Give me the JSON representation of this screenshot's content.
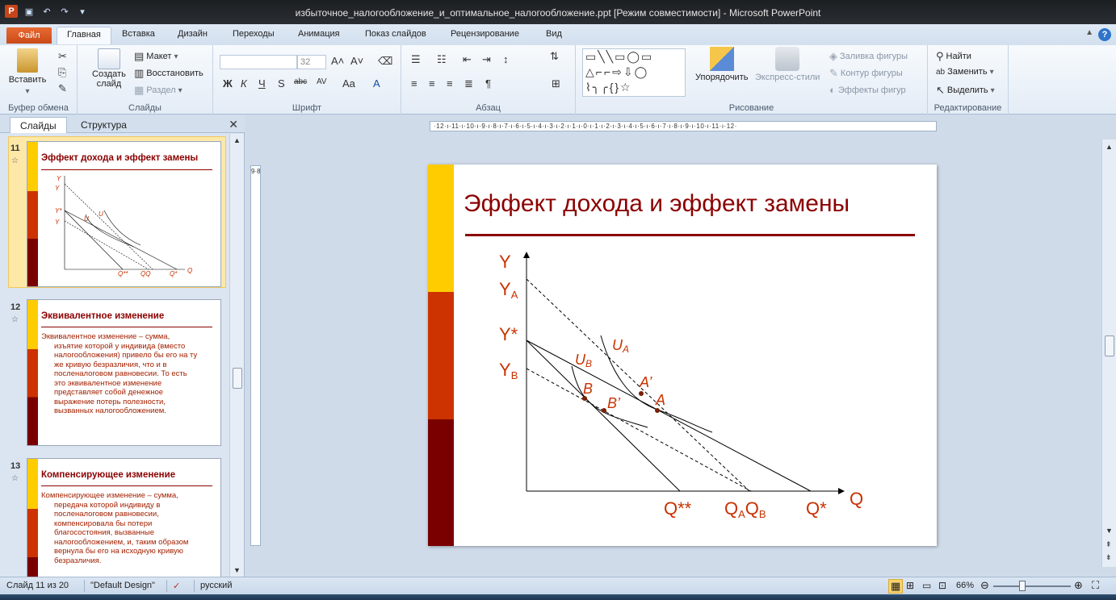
{
  "window": {
    "title": "избыточное_налогообложение_и_оптимальное_налогообложение.ppt [Режим совместимости] - Microsoft PowerPoint"
  },
  "tabs": {
    "file": "Файл",
    "items": [
      "Главная",
      "Вставка",
      "Дизайн",
      "Переходы",
      "Анимация",
      "Показ слайдов",
      "Рецензирование",
      "Вид"
    ]
  },
  "ribbon": {
    "clipboard": {
      "paste": "Вставить",
      "label": "Буфер обмена"
    },
    "slides": {
      "new_slide_1": "Создать",
      "new_slide_2": "слайд",
      "layout": "Макет",
      "reset": "Восстановить",
      "section": "Раздел",
      "label": "Слайды"
    },
    "font": {
      "size": "32",
      "label": "Шрифт"
    },
    "paragraph": {
      "label": "Абзац"
    },
    "drawing": {
      "arrange": "Упорядочить",
      "quick_styles": "Экспресс-стили",
      "fill": "Заливка фигуры",
      "outline": "Контур фигуры",
      "effects": "Эффекты фигур",
      "label": "Рисование"
    },
    "editing": {
      "find": "Найти",
      "replace": "Заменить",
      "select": "Выделить",
      "label": "Редактирование"
    }
  },
  "pane": {
    "tab_slides": "Слайды",
    "tab_outline": "Структура",
    "thumbs": [
      {
        "num": "11",
        "title": "Эффект дохода и эффект замены",
        "lines": []
      },
      {
        "num": "12",
        "title": "Эквивалентное изменение",
        "lines": [
          "Эквивалентное изменение – сумма,",
          "изъятие которой у индивида (вместо",
          "налогообложения) привело бы его на ту",
          "же кривую безразличия, что и в",
          "посленалоговом равновесии. То есть",
          "это эквивалентное изменение",
          "представляет собой денежное",
          "выражение потерь полезности,",
          "вызванных налогообложением."
        ]
      },
      {
        "num": "13",
        "title": "Компенсирующее  изменение",
        "lines": [
          "Компенсирующее изменение – сумма,",
          "передача которой индивиду в",
          "посленалоговом равновесии,",
          "компенсировала бы потери",
          "благосостояния, вызванные",
          "налогообложением, и, таким образом",
          "вернула бы его на исходную кривую",
          "безразличия."
        ]
      }
    ]
  },
  "ruler": {
    "horizontal": "·12·ı·11·ı·10·ı·9·ı·8·ı·7·ı·6·ı·5·ı·4·ı·3·ı·2·ı·1·ı·0·ı·1·ı·2·ı·3·ı·4·ı·5·ı·6·ı·7·ı·8·ı·9·ı·10·ı·11·ı·12·",
    "vertical": "9·8·7·6·5·4·3·2·1·0·1·2·3·4·5·6·7·8·9"
  },
  "slide": {
    "title": "Эффект дохода и эффект замены",
    "colors": {
      "bar_top": "#ffcc00",
      "bar_mid": "#cc3300",
      "bar_bot": "#7a0000",
      "title": "#8b0000",
      "labels": "#c83200"
    }
  },
  "chart_data": {
    "type": "diagram",
    "axis_labels": {
      "y": "Y",
      "x": "Q"
    },
    "y_ticks": [
      "YA",
      "Y*",
      "YB"
    ],
    "x_ticks": [
      "Q**",
      "QAQB",
      "Q*"
    ],
    "curves": [
      "UA",
      "UB"
    ],
    "points": [
      "A",
      "A’",
      "B",
      "B’"
    ]
  },
  "status": {
    "slide": "Слайд 11 из 20",
    "design": "\"Default Design\"",
    "language": "русский",
    "zoom": "66%"
  }
}
